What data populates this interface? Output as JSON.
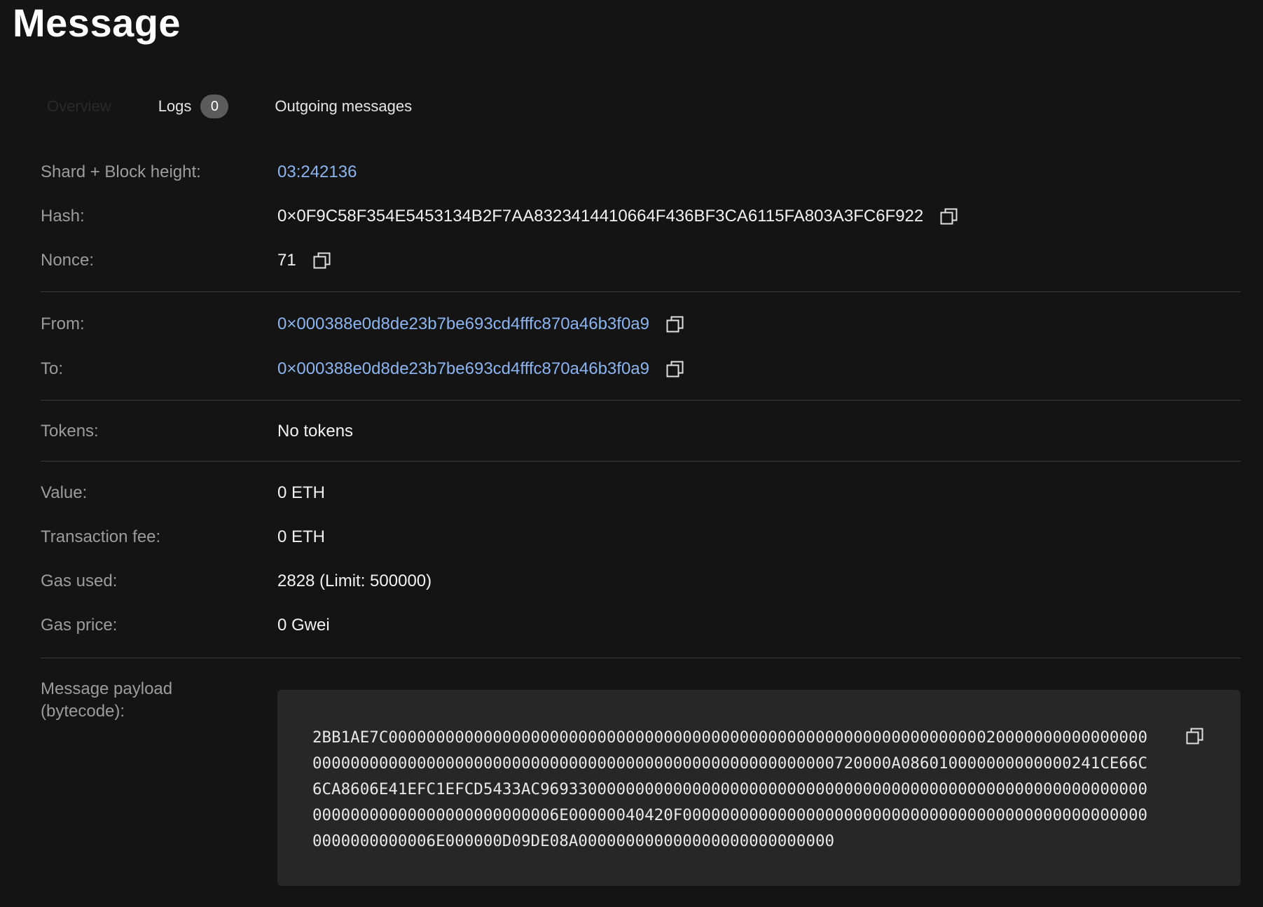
{
  "page": {
    "title": "Message"
  },
  "tabs": {
    "overview": "Overview",
    "logs": "Logs",
    "logs_count": "0",
    "outgoing": "Outgoing messages"
  },
  "fields": {
    "shard_block": {
      "label": "Shard + Block height:",
      "value": "03:242136"
    },
    "hash": {
      "label": "Hash:",
      "value": "0×0F9C58F354E5453134B2F7AA8323414410664F436BF3CA6115FA803A3FC6F922"
    },
    "nonce": {
      "label": "Nonce:",
      "value": "71"
    },
    "from": {
      "label": "From:",
      "value": "0×000388e0d8de23b7be693cd4fffc870a46b3f0a9"
    },
    "to": {
      "label": "To:",
      "value": "0×000388e0d8de23b7be693cd4fffc870a46b3f0a9"
    },
    "tokens": {
      "label": "Tokens:",
      "value": "No tokens"
    },
    "value": {
      "label": "Value:",
      "value": "0 ETH"
    },
    "fee": {
      "label": "Transaction fee:",
      "value": "0 ETH"
    },
    "gas_used": {
      "label": "Gas used:",
      "value": "2828 (Limit: 500000)"
    },
    "gas_price": {
      "label": "Gas price:",
      "value": "0 Gwei"
    }
  },
  "payload": {
    "label_line1": "Message payload",
    "label_line2": "(bytecode):",
    "bytecode": "2BB1AE7C000000000000000000000000000000000000000000000000000000000000000200000000000000000000000000000000000000000000000000000000000000000000000720000A086010000000000000241CE66C6CA8606E41EFC1EFCD5433AC969330000000000000000000000000000000000000000000000000000000000000000000000000000000000006E00000040420F00000000000000000000000000000000000000000000000000000000000006E000000D09DE08A000000000000000000000000000"
  },
  "icons": {
    "copy": "copy-icon"
  },
  "colors": {
    "background": "#141414",
    "link": "#8cb4f0",
    "label": "#9c9c9c",
    "payload_bg": "#272727",
    "badge_bg": "#5c5c5c"
  }
}
